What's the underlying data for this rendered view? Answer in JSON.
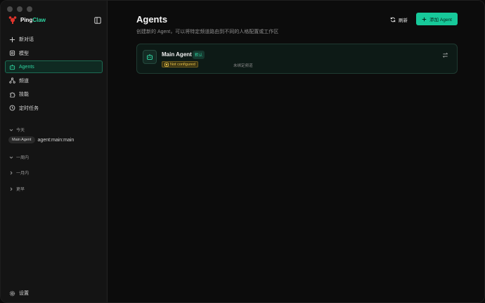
{
  "app": {
    "brand_part1": "Ping",
    "brand_part2": "Claw"
  },
  "sidebar": {
    "nav": [
      {
        "label": "新对话",
        "icon": "plus-icon"
      },
      {
        "label": "模型",
        "icon": "cube-icon"
      },
      {
        "label": "Agents",
        "icon": "bot-icon",
        "active": true
      },
      {
        "label": "频道",
        "icon": "network-icon"
      },
      {
        "label": "技能",
        "icon": "puzzle-icon"
      },
      {
        "label": "定时任务",
        "icon": "clock-icon"
      }
    ],
    "groups": {
      "today": "今天",
      "week": "一周内",
      "month": "一月内",
      "earlier": "更早"
    },
    "recent": {
      "chip": "Main Agent",
      "text": "agent:main:main"
    },
    "settings_label": "设置"
  },
  "main": {
    "title": "Agents",
    "subtitle": "创建新的 Agent，可以将特定频道路由到不同的人格配置或工作区",
    "refresh_label": "刷新",
    "add_label": "添加 Agent",
    "agents": [
      {
        "name": "Main Agent",
        "default_badge": "默认",
        "status": "Not configured",
        "binding": "未绑定频道"
      }
    ]
  },
  "colors": {
    "accent": "#2ed3a0",
    "button": "#17c99a",
    "warning": "#e8c44a",
    "background": "#0c0c0c",
    "sidebar": "#141414"
  }
}
